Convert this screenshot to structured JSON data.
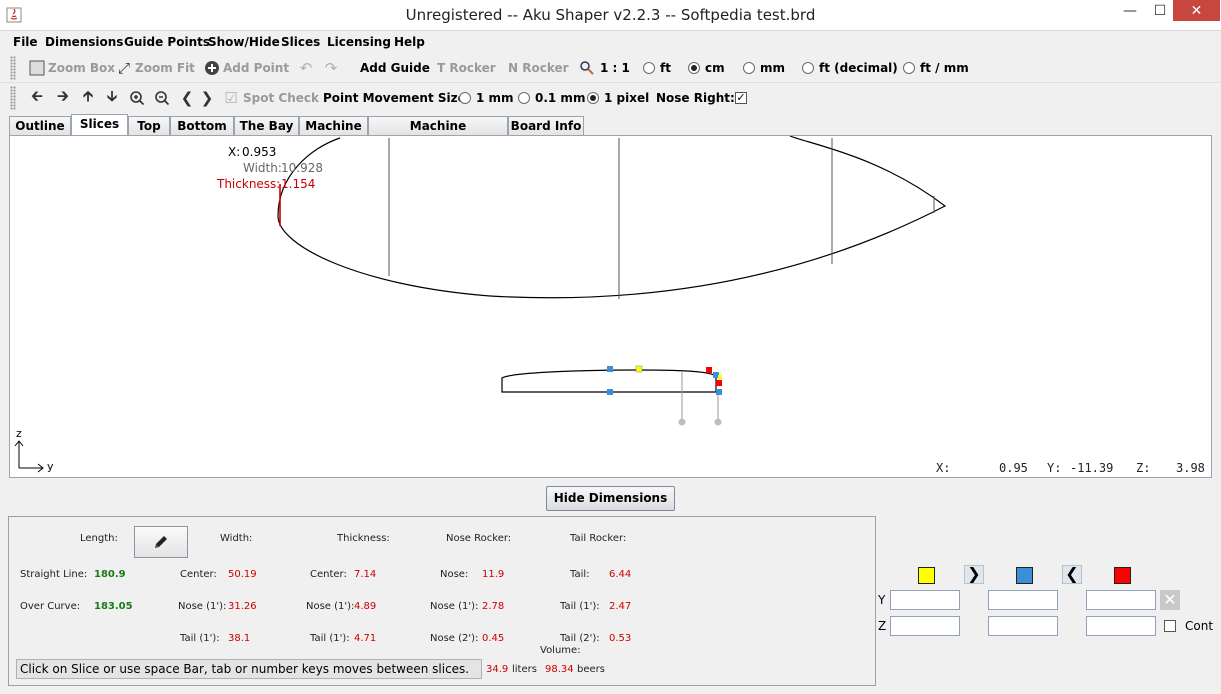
{
  "window": {
    "title": "Unregistered -- Aku Shaper v2.2.3  --  Softpedia test.brd"
  },
  "menu": [
    "File",
    "Dimensions",
    "Guide Points",
    "Show/Hide",
    "Slices",
    "Licensing",
    "Help"
  ],
  "toolbar1": {
    "zoom_box": "Zoom Box",
    "zoom_fit": "Zoom Fit",
    "add_point": "Add Point",
    "add_guide": "Add Guide",
    "t_rocker": "T Rocker",
    "n_rocker": "N Rocker",
    "scale": "1 : 1",
    "units": [
      {
        "label": "ft",
        "selected": false
      },
      {
        "label": "cm",
        "selected": true
      },
      {
        "label": "mm",
        "selected": false
      },
      {
        "label": "ft (decimal)",
        "selected": false
      },
      {
        "label": "ft / mm",
        "selected": false
      }
    ]
  },
  "toolbar2": {
    "spot_check": "Spot Check",
    "point_movement_label": "Point Movement Size:",
    "movement_options": [
      {
        "label": "1 mm",
        "selected": false
      },
      {
        "label": "0.1 mm",
        "selected": false
      },
      {
        "label": "1 pixel",
        "selected": true
      }
    ],
    "nose_right_label": "Nose Right:",
    "nose_right_checked": true
  },
  "tabs": [
    "Outline",
    "Slices",
    "Top",
    "Bottom",
    "The Bay",
    "Machine",
    "Machine Parameters",
    "Board Info"
  ],
  "active_tab": "Slices",
  "canvas": {
    "x_label": "X:",
    "x_value": "0.953",
    "width_label": "Width:",
    "width_value": "10.928",
    "thickness_label": "Thickness:",
    "thickness_value": "1.154",
    "axis_z": "z",
    "axis_y": "y",
    "cursor": {
      "x_label": "X:",
      "x": "0.95",
      "y_label": "Y:",
      "y": "-11.39",
      "z_label": "Z:",
      "z": "3.98"
    }
  },
  "hide_dimensions_label": "Hide Dimensions",
  "dimensions": {
    "length_label": "Length:",
    "width_label": "Width:",
    "thickness_label": "Thickness:",
    "nose_rocker_label": "Nose Rocker:",
    "tail_rocker_label": "Tail Rocker:",
    "straight_line_label": "Straight Line:",
    "straight_line": "180.9",
    "over_curve_label": "Over Curve:",
    "over_curve": "183.05",
    "w_center_label": "Center:",
    "w_center": "50.19",
    "w_nose1_label": "Nose (1'):",
    "w_nose1": "31.26",
    "w_tail1_label": "Tail (1'):",
    "w_tail1": "38.1",
    "t_center_label": "Center:",
    "t_center": "7.14",
    "t_nose1_label": "Nose (1'):",
    "t_nose1": "4.89",
    "t_tail1_label": "Tail (1'):",
    "t_tail1": "4.71",
    "nr_nose_label": "Nose:",
    "nr_nose": "11.9",
    "nr_nose1_label": "Nose (1'):",
    "nr_nose1": "2.78",
    "nr_nose2_label": "Nose (2'):",
    "nr_nose2": "0.45",
    "tr_tail_label": "Tail:",
    "tr_tail": "6.44",
    "tr_tail1_label": "Tail (1'):",
    "tr_tail1": "2.47",
    "tr_tail2_label": "Tail (2'):",
    "tr_tail2": "0.53",
    "volume_label": "Volume:",
    "volume_liters": "34.9",
    "liters_label": "liters",
    "volume_beers": "98.34",
    "beers_label": "beers",
    "status": "Click on Slice or use space Bar, tab or number keys moves between slices."
  },
  "point_editor": {
    "colors": {
      "yellow": "#ffff00",
      "blue": "#3a8fd8",
      "red": "#ff0000"
    },
    "y_label": "Y",
    "z_label": "Z",
    "cont_label": "Cont"
  }
}
